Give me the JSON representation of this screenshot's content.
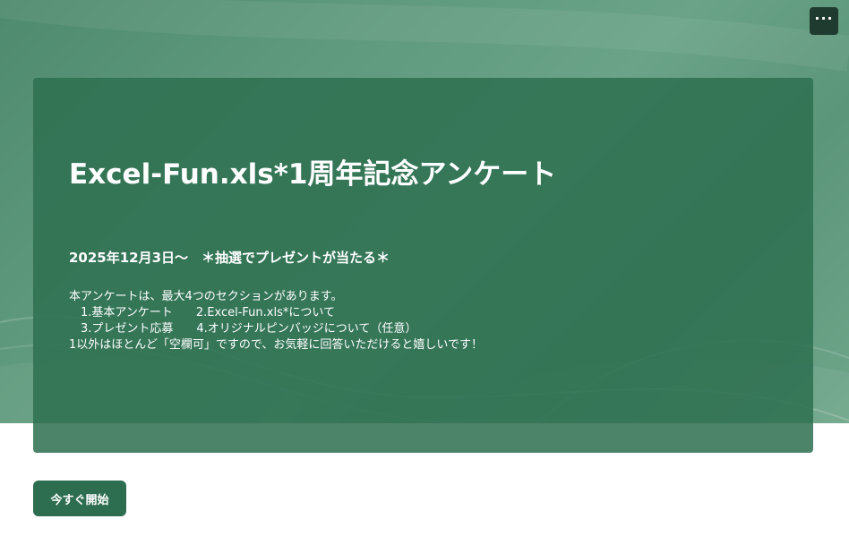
{
  "header": {
    "menu_icon": "more-horizontal-icon",
    "menu_label": "···"
  },
  "survey": {
    "title": "Excel-Fun.xls*1周年記念アンケート",
    "subtitle": "2025年12月3日〜　＊抽選でプレゼントが当たる＊",
    "description": [
      "本アンケートは、最大4つのセクションがあります。",
      "　1.基本アンケート　　2.Excel-Fun.xls*について",
      "　3.プレゼント応募　　4.オリジナルピンバッジについて（任意）",
      "1以外はほとんど「空欄可」ですので、お気軽に回答いただけると嬉しいです！"
    ]
  },
  "actions": {
    "start_label": "今すぐ開始"
  },
  "colors": {
    "hero_bg": "#5f9a7e",
    "card_bg": "#2d7050",
    "button_bg": "#2e6e50",
    "menu_bg": "#1f3a2e"
  }
}
